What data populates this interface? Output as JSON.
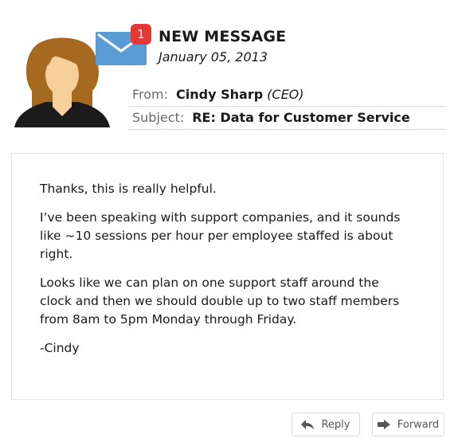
{
  "header": {
    "badge_count": "1",
    "title": "NEW MESSAGE",
    "date": "January 05, 2013"
  },
  "meta": {
    "from_label": "From:",
    "sender_name": "Cindy Sharp",
    "sender_role": "(CEO)",
    "subject_label": "Subject:",
    "subject": "RE: Data for Customer Service"
  },
  "body": {
    "paragraphs": [
      "Thanks, this is really helpful.",
      "I’ve been speaking with support companies, and it sounds like ~10 sessions per hour per employee staffed is about right.",
      "Looks like we can plan on one support staff around the clock and then we should double up to two staff members from 8am to 5pm Monday through Friday.",
      "-Cindy"
    ]
  },
  "actions": {
    "reply_label": "Reply",
    "forward_label": "Forward"
  },
  "icons": {
    "avatar": "woman-avatar-icon",
    "mail": "envelope-icon",
    "reply": "reply-arrow-icon",
    "forward": "forward-arrow-icon"
  },
  "colors": {
    "badge": "#e53935",
    "envelope": "#5b9bd5",
    "hair": "#a56a1f",
    "skin": "#f6cf9a",
    "shirt": "#1b1b1b"
  }
}
